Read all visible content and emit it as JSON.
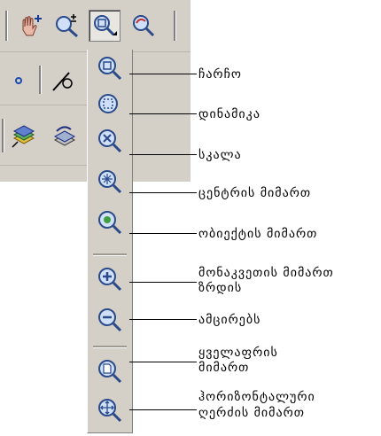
{
  "flyout": {
    "items": [
      {
        "icon": "zoom-window-icon",
        "label": "ჩარჩო"
      },
      {
        "icon": "zoom-dynamic-icon",
        "label": "დინამიკა"
      },
      {
        "icon": "zoom-scale-icon",
        "label": "სკალა"
      },
      {
        "icon": "zoom-center-icon",
        "label": "ცენტრის მიმართ"
      },
      {
        "icon": "zoom-object-icon",
        "label": "ობიექტის მიმართ"
      },
      {
        "icon": "zoom-in-icon",
        "label_line1": "მონაკვეთის მიმართ",
        "label_line2": "ზრდის"
      },
      {
        "icon": "zoom-out-icon",
        "label": "ამცირებს"
      },
      {
        "icon": "zoom-all-icon",
        "label_line1": "ყველაფრის",
        "label_line2": "მიმართ"
      },
      {
        "icon": "zoom-extents-icon",
        "label_line1": "ჰორიზონტალური",
        "label_line2": "ღერძის მიმართ"
      }
    ]
  }
}
